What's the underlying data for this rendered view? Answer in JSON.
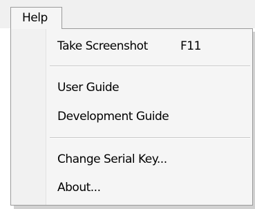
{
  "menubar": {
    "active_menu": "Help"
  },
  "menu": {
    "items": [
      {
        "label": "Take Screenshot",
        "shortcut": "F11"
      },
      {
        "label": "User Guide"
      },
      {
        "label": "Development Guide"
      },
      {
        "label": "Change Serial Key..."
      },
      {
        "label": "About..."
      }
    ]
  }
}
